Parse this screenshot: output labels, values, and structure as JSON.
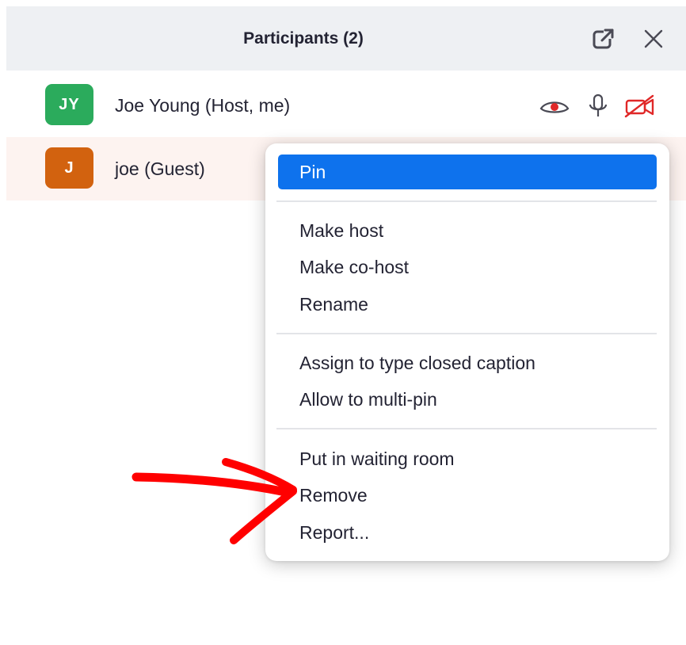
{
  "panel": {
    "title": "Participants (2)",
    "header_icons": [
      "popout-icon",
      "close-icon"
    ]
  },
  "participants": [
    {
      "initials": "JY",
      "name": "Joe Young (Host, me)",
      "avatar_color": "#2bab5c",
      "status_icons": [
        "eye-icon",
        "microphone-icon",
        "video-off-icon"
      ]
    },
    {
      "initials": "J",
      "name": "joe (Guest)",
      "avatar_color": "#d2620f"
    }
  ],
  "context_menu": {
    "groups": [
      [
        "Pin"
      ],
      [
        "Make host",
        "Make co-host",
        "Rename"
      ],
      [
        "Assign to type closed caption",
        "Allow to multi-pin"
      ],
      [
        "Put in waiting room",
        "Remove",
        "Report..."
      ]
    ],
    "highlighted_item": "Pin"
  },
  "colors": {
    "header_bg": "#eef0f3",
    "highlight_blue": "#0e72ed",
    "guest_row_bg": "#fdf3f0",
    "video_off_red": "#e02828",
    "annotation_red": "#ff0000"
  }
}
